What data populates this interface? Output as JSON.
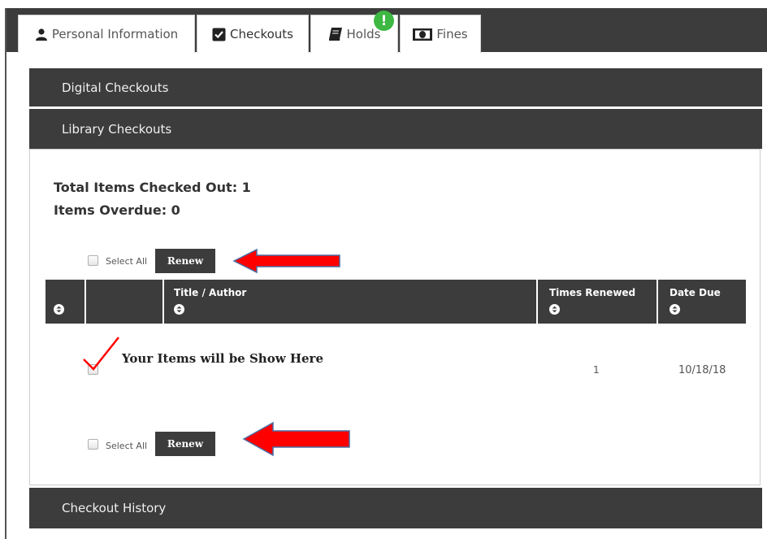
{
  "tabs": [
    {
      "label": "Personal Information",
      "icon": "person-icon"
    },
    {
      "label": "Checkouts",
      "icon": "checkbox-icon"
    },
    {
      "label": "Holds",
      "icon": "book-icon"
    },
    {
      "label": "Fines",
      "icon": "money-icon"
    }
  ],
  "holds_badge": "!",
  "sections": {
    "digital": "Digital Checkouts",
    "library": "Library Checkouts",
    "history": "Checkout History"
  },
  "summary": {
    "total": "Total Items Checked Out: 1",
    "overdue": "Items Overdue: 0"
  },
  "controls": {
    "select_all": "Select All",
    "renew": "Renew"
  },
  "table": {
    "headers": [
      "Title / Author",
      "Times Renewed",
      "Date Due"
    ],
    "rows": [
      {
        "title": "Your Items will be Show Here",
        "times_renewed": "1",
        "date_due": "10/18/18"
      }
    ]
  },
  "colors": {
    "dark_bar": "#3c3c3c",
    "badge": "#3db843",
    "annotation_arrow": "#ff0000"
  }
}
